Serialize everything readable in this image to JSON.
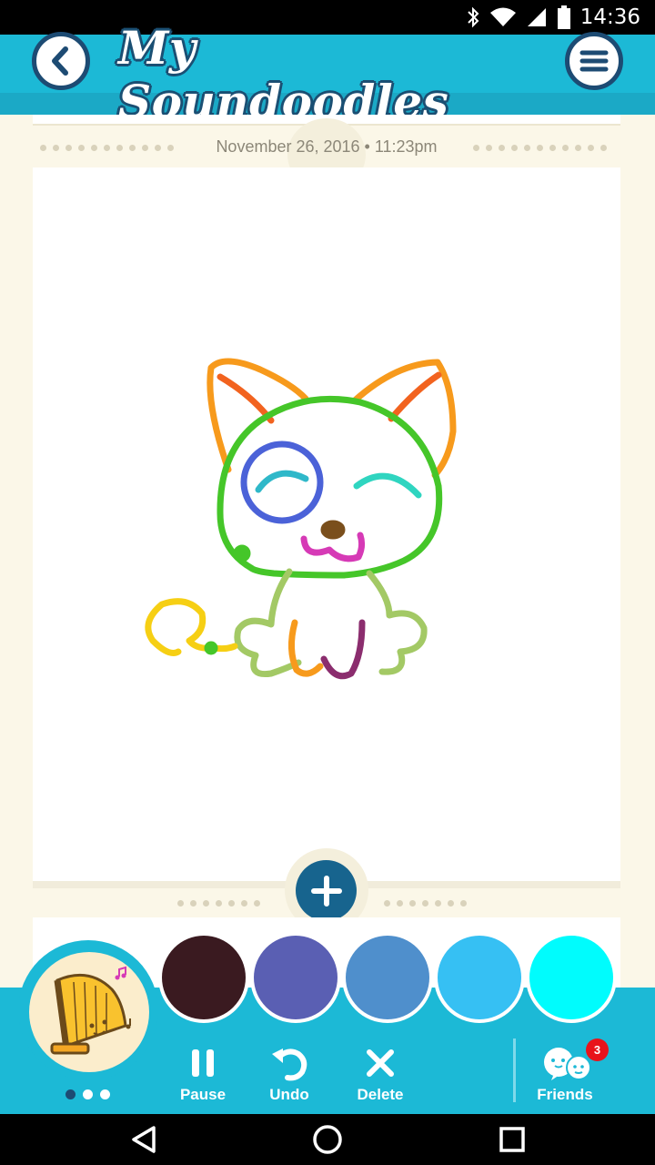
{
  "status_bar": {
    "time": "14:36",
    "icons": [
      "bluetooth-icon",
      "wifi-icon",
      "signal-icon",
      "battery-icon"
    ]
  },
  "header": {
    "title": "My Soundoodles",
    "back_icon": "chevron-left-icon",
    "menu_icon": "hamburger-menu-icon"
  },
  "doodle": {
    "date": "November 26, 2016 • 11:23pm"
  },
  "palette": {
    "colors": [
      "#3a1a20",
      "#5a5fb3",
      "#4f8fcc",
      "#36c0f3",
      "#00fcfd"
    ]
  },
  "instrument": {
    "name_icon": "harp-icon",
    "page_count": 3,
    "active_page": 1
  },
  "toolbar": {
    "pause_label": "Pause",
    "undo_label": "Undo",
    "delete_label": "Delete",
    "friends_label": "Friends",
    "friends_badge": "3"
  },
  "colors": {
    "accent": "#1cb9d6",
    "dark": "#1d4b73",
    "badge": "#e8131b"
  }
}
